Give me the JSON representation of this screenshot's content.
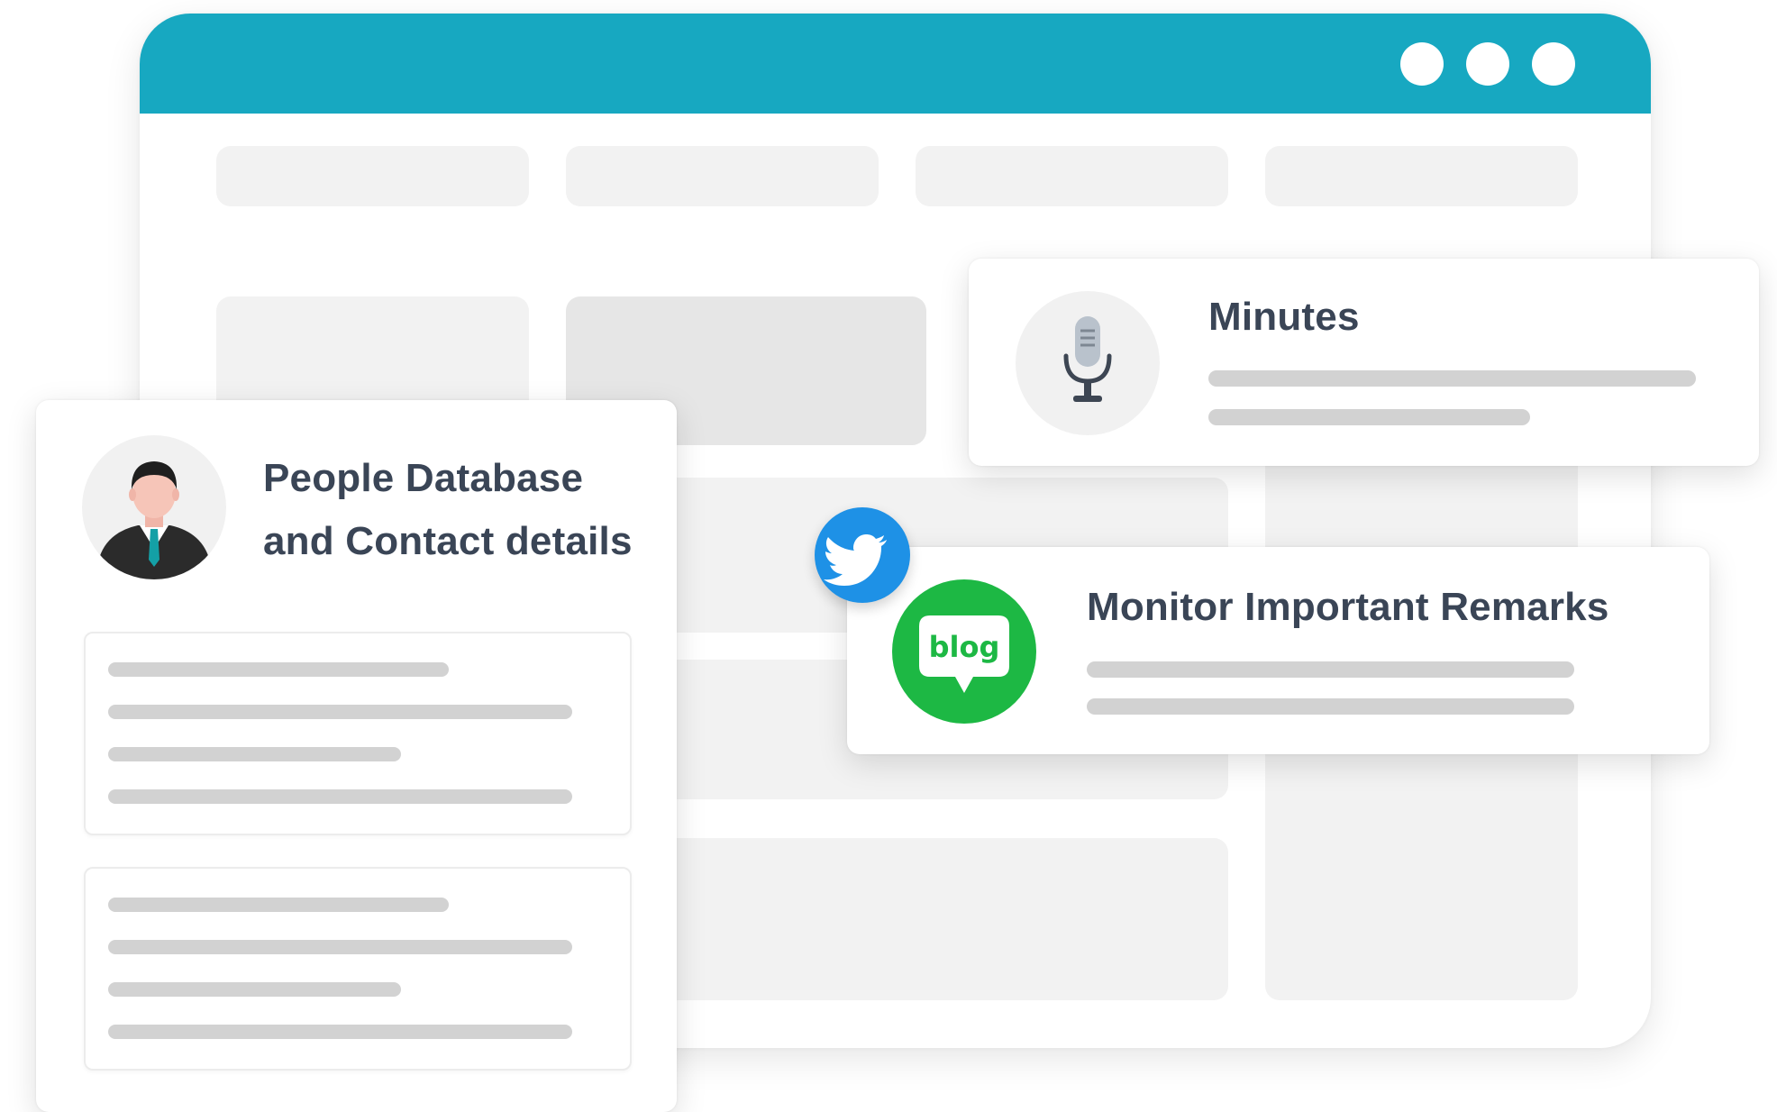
{
  "colors": {
    "accent": "#17a8c1",
    "twitter": "#1e91e6",
    "blog": "#1db844",
    "title_text": "#3a4556",
    "placeholder_line": "#d2d2d2"
  },
  "browser": {
    "window_controls": [
      "dot",
      "dot",
      "dot"
    ]
  },
  "cards": {
    "people": {
      "title_line1": "People Database",
      "title_line2": "and Contact details",
      "icon": "person-avatar-icon"
    },
    "minutes": {
      "title": "Minutes",
      "icon": "microphone-icon"
    },
    "remarks": {
      "title": "Monitor Important Remarks",
      "icon": "blog-icon",
      "badge_icon": "twitter-icon",
      "blog_text": "blog"
    }
  }
}
